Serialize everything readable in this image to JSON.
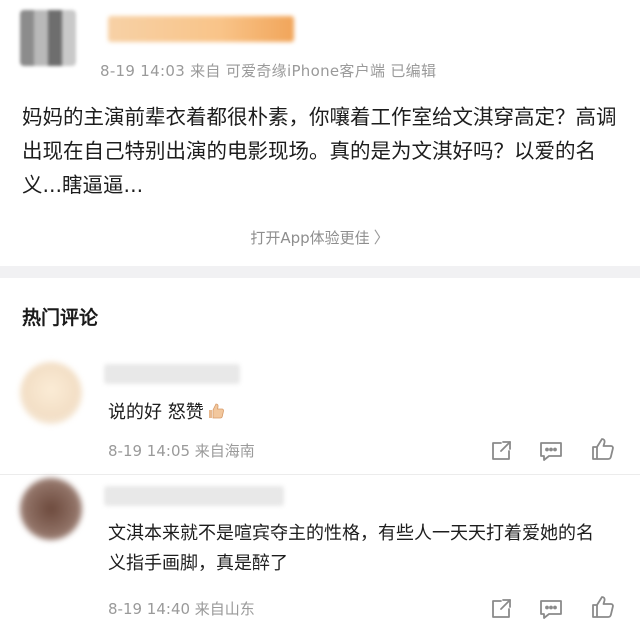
{
  "post": {
    "meta": "8-19 14:03 来自 可爱奇缘iPhone客户端 已编辑",
    "body": "妈妈的主演前辈衣着都很朴素，你嚷着工作室给文淇穿高定？高调出现在自己特别出演的电影现场。真的是为文淇好吗？以爱的名义...瞎逼逼...",
    "open_app": "打开App体验更佳"
  },
  "hot_comments": {
    "title": "热门评论",
    "items": [
      {
        "text": "说的好 怒赞",
        "emoji_icon": "thumbs-up-emoji",
        "meta": "8-19 14:05 来自海南"
      },
      {
        "text": "文淇本来就不是喧宾夺主的性格，有些人一天天打着爱她的名义指手画脚，真是醉了",
        "meta": "8-19 14:40 来自山东"
      }
    ]
  },
  "icons": {
    "share": "share-icon",
    "reply": "comment-icon",
    "like": "thumbs-up-icon"
  },
  "colors": {
    "meta_text": "#9a9a9a",
    "divider": "#f1f1f3",
    "icon": "#8a8a8a"
  }
}
